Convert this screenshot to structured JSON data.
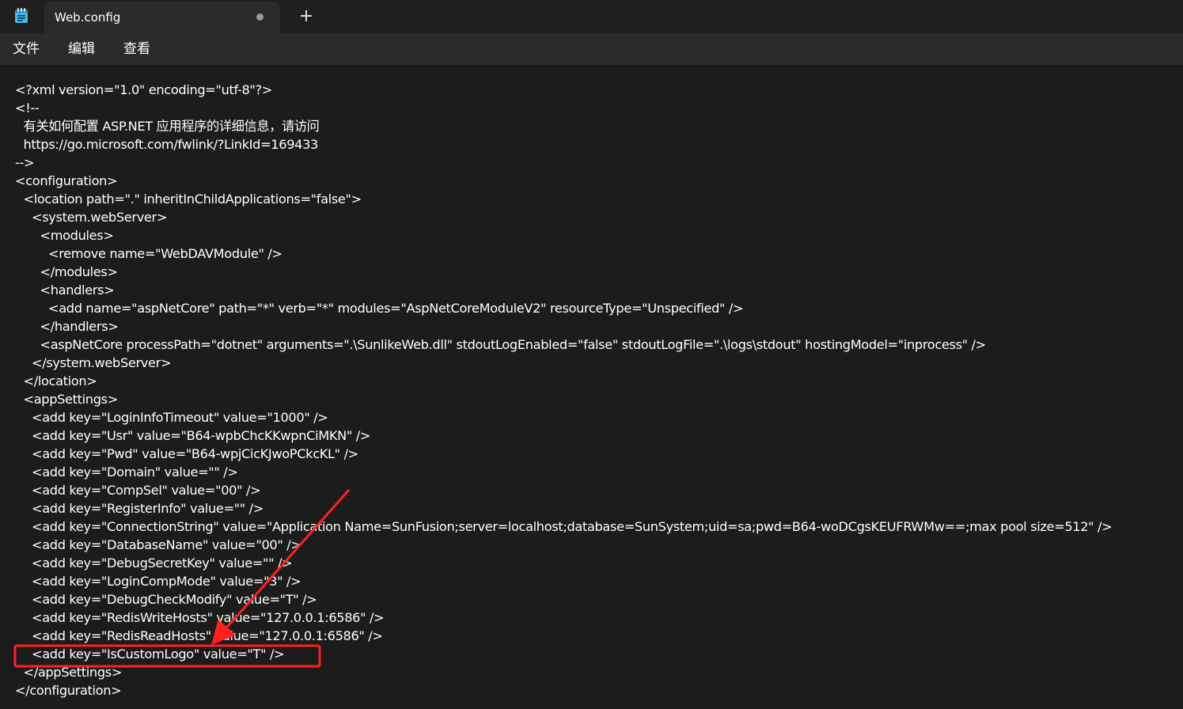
{
  "window": {
    "tab_title": "Web.config",
    "new_tab_label": "+"
  },
  "menu": {
    "items": [
      "文件",
      "编辑",
      "查看"
    ]
  },
  "editor": {
    "lines": [
      {
        "indent": 0,
        "text": "<?xml version=\"1.0\" encoding=\"utf-8\"?>"
      },
      {
        "indent": 0,
        "text": "<!--"
      },
      {
        "indent": 1,
        "text": "有关如何配置 ASP.NET 应用程序的详细信息，请访问"
      },
      {
        "indent": 1,
        "text": "https://go.microsoft.com/fwlink/?LinkId=169433"
      },
      {
        "indent": 0,
        "text": "-->"
      },
      {
        "indent": 0,
        "text": "<configuration>"
      },
      {
        "indent": 1,
        "text": "<location path=\".\" inheritInChildApplications=\"false\">"
      },
      {
        "indent": 2,
        "text": "<system.webServer>"
      },
      {
        "indent": 3,
        "text": "<modules>"
      },
      {
        "indent": 4,
        "text": "<remove name=\"WebDAVModule\" />"
      },
      {
        "indent": 3,
        "text": "</modules>"
      },
      {
        "indent": 3,
        "text": "<handlers>"
      },
      {
        "indent": 4,
        "text": "<add name=\"aspNetCore\" path=\"*\" verb=\"*\" modules=\"AspNetCoreModuleV2\" resourceType=\"Unspecified\" />"
      },
      {
        "indent": 3,
        "text": "</handlers>"
      },
      {
        "indent": 3,
        "text": "<aspNetCore processPath=\"dotnet\" arguments=\".\\SunlikeWeb.dll\" stdoutLogEnabled=\"false\" stdoutLogFile=\".\\logs\\stdout\" hostingModel=\"inprocess\" />"
      },
      {
        "indent": 2,
        "text": "</system.webServer>"
      },
      {
        "indent": 1,
        "text": "</location>"
      },
      {
        "indent": 1,
        "text": "<appSettings>"
      },
      {
        "indent": 2,
        "text": "<add key=\"LoginInfoTimeout\" value=\"1000\" />"
      },
      {
        "indent": 2,
        "text": "<add key=\"Usr\" value=\"B64-wpbChcKKwpnCiMKN\" />"
      },
      {
        "indent": 2,
        "text": "<add key=\"Pwd\" value=\"B64-wpjCicKJwoPCkcKL\" />"
      },
      {
        "indent": 2,
        "text": "<add key=\"Domain\" value=\"\" />"
      },
      {
        "indent": 2,
        "text": "<add key=\"CompSel\" value=\"00\" />"
      },
      {
        "indent": 2,
        "text": "<add key=\"RegisterInfo\" value=\"\" />"
      },
      {
        "indent": 2,
        "text": "<add key=\"ConnectionString\" value=\"Application Name=SunFusion;server=localhost;database=SunSystem;uid=sa;pwd=B64-woDCgsKEUFRWMw==;max pool size=512\" />"
      },
      {
        "indent": 2,
        "text": "<add key=\"DatabaseName\" value=\"00\" />"
      },
      {
        "indent": 2,
        "text": "<add key=\"DebugSecretKey\" value=\"\" />"
      },
      {
        "indent": 2,
        "text": "<add key=\"LoginCompMode\" value=\"3\" />"
      },
      {
        "indent": 2,
        "text": "<add key=\"DebugCheckModify\" value=\"T\" />"
      },
      {
        "indent": 2,
        "text": "<add key=\"RedisWriteHosts\" value=\"127.0.0.1:6586\" />"
      },
      {
        "indent": 2,
        "text": "<add key=\"RedisReadHosts\" value=\"127.0.0.1:6586\" />"
      },
      {
        "indent": 2,
        "text": "<add key=\"IsCustomLogo\" value=\"T\" />"
      },
      {
        "indent": 1,
        "text": "</appSettings>"
      },
      {
        "indent": 0,
        "text": "</configuration>"
      }
    ]
  },
  "annotation": {
    "color": "#ff2020"
  }
}
